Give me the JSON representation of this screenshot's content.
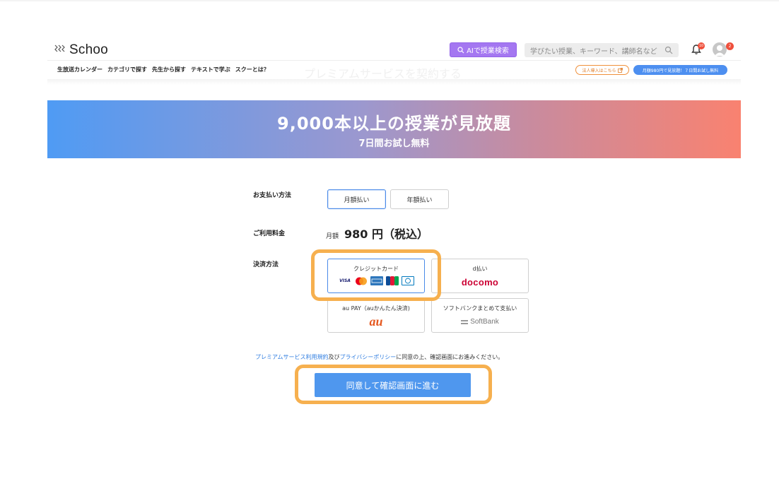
{
  "header": {
    "logo_text": "Schoo",
    "ai_search_label": "AIで授業検索",
    "search_placeholder": "学びたい授業、キーワード、講師名など",
    "notification_count": "10",
    "avatar_badge": "2",
    "nav": [
      "生放送カレンダー",
      "カテゴリで探す",
      "先生から探す",
      "テキストで学ぶ",
      "スクーとは？"
    ],
    "ghost_title": "プレミアムサービスを契約する",
    "corporate_label": "法人導入はこちら",
    "trial_label": "月額980円で見放題！７日間お試し無料"
  },
  "banner": {
    "title": "9,000本以上の授業が見放題",
    "subtitle": "7日間お試し無料"
  },
  "form": {
    "payment_cycle_label": "お支払い方法",
    "cycle_options": [
      "月額払い",
      "年額払い"
    ],
    "selected_cycle": "月額払い",
    "fee_label": "ご利用料金",
    "fee_unit": "月額",
    "fee_value": "980 円（税込）",
    "method_label": "決済方法",
    "methods": {
      "credit_card": "クレジットカード",
      "d_pay": "d払い",
      "docomo": "docomo",
      "au_pay": "au PAY（auかんたん決済)",
      "au": "au",
      "softbank_pay": "ソフトバンクまとめて支払い",
      "softbank": "SoftBank"
    },
    "selected_method": "クレジットカード",
    "card_brands": [
      "VISA",
      "Mastercard",
      "AMEX",
      "JCB",
      "Diners"
    ]
  },
  "terms": {
    "link1": "プレミアムサービス利用規約",
    "and": "及び",
    "link2": "プライバシーポリシー",
    "rest": "に同意の上、確認画面にお進みください。"
  },
  "submit_label": "同意して確認画面に進む",
  "colors": {
    "accent_blue": "#4f97ee",
    "highlight_orange": "#f6b04f",
    "ai_purple": "#a477f1",
    "banner_start": "#4f9bf4",
    "banner_end": "#f98270"
  }
}
